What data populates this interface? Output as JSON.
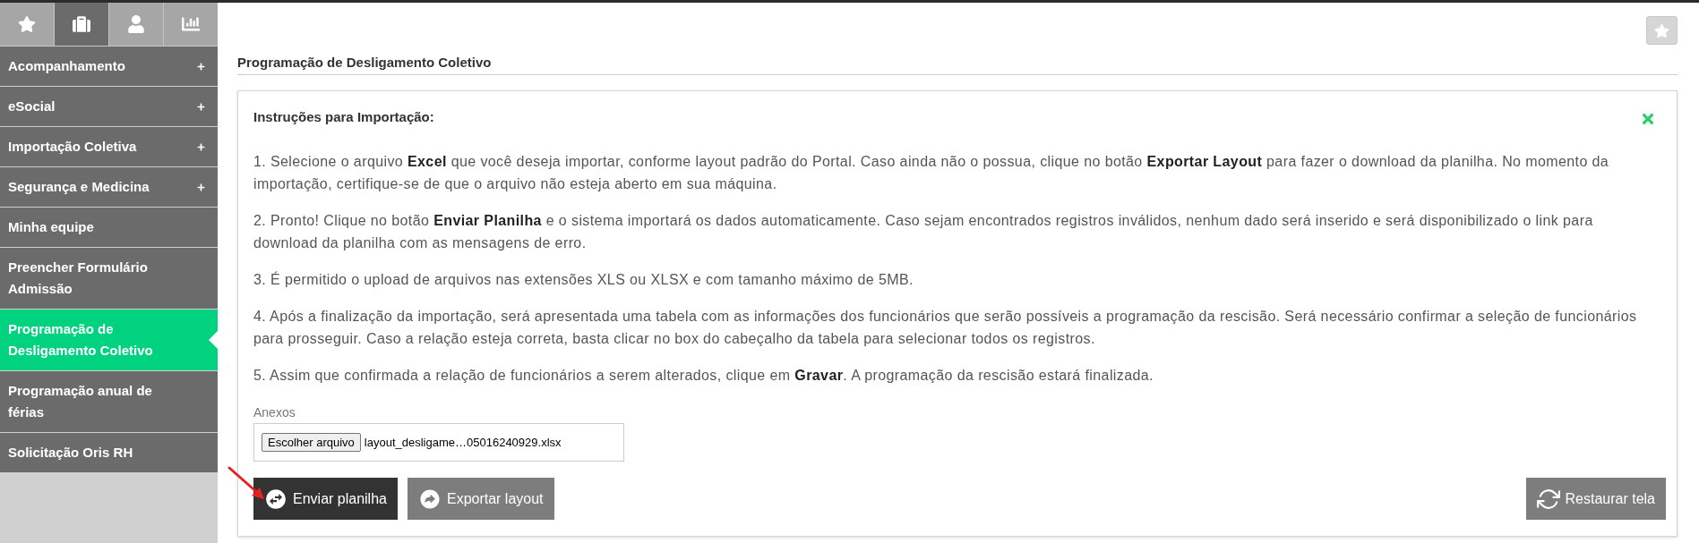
{
  "sidebar": {
    "tabs": [
      {
        "selected": false
      },
      {
        "selected": true
      },
      {
        "selected": false
      },
      {
        "selected": false
      }
    ],
    "menu": [
      {
        "label": "Acompanhamento",
        "kind": "group",
        "selected": false
      },
      {
        "label": "eSocial",
        "kind": "group",
        "selected": false
      },
      {
        "label": "Importação Coletiva",
        "kind": "group",
        "selected": false
      },
      {
        "label": "Segurança e Medicina",
        "kind": "group",
        "selected": false
      },
      {
        "label": "Minha equipe",
        "kind": "link",
        "selected": false
      },
      {
        "label": "Preencher Formulário Admissão",
        "kind": "link",
        "selected": false
      },
      {
        "label": "Programação de Desligamento Coletivo",
        "kind": "link",
        "selected": true
      },
      {
        "label": "Programação anual de férias",
        "kind": "link",
        "selected": false
      },
      {
        "label": "Solicitação Oris RH",
        "kind": "link",
        "selected": false
      }
    ]
  },
  "page_title": "Programação de Desligamento Coletivo",
  "instructions": {
    "title": "Instruções para Importação:",
    "paragraphs": [
      "1. Selecione o arquivo **Excel** que você deseja importar, conforme layout padrão do Portal. Caso ainda não o possua, clique no botão **Exportar Layout** para fazer o download da planilha. No momento da importação, certifique-se de que o arquivo não esteja aberto em sua máquina.",
      "2. Pronto! Clique no botão **Enviar Planilha** e o sistema importará os dados automaticamente. Caso sejam encontrados registros inválidos, nenhum dado será inserido e será disponibilizado o link para download da planilha com as mensagens de erro.",
      "3. É permitido o upload de arquivos nas extensões XLS ou XLSX e com tamanho máximo de 5MB.",
      "4. Após a finalização da importação, será apresentada uma tabela com as informações dos funcionários que serão possíveis a programação da rescisão. Será necessário confirmar a seleção de funcionários para prosseguir. Caso a relação esteja correta, basta clicar no box do cabeçalho da tabela para selecionar todos os registros.",
      "5. Assim que confirmada a relação de funcionários a serem alterados, clique em **Gravar**. A programação da rescisão estará finalizada."
    ]
  },
  "attachments": {
    "label": "Anexos",
    "choose_button": "Escolher arquivo",
    "file_name": "layout_desligame…05016240929.xlsx"
  },
  "buttons": [
    {
      "label": "Enviar planilha",
      "kind": "send"
    },
    {
      "label": "Exportar layout",
      "kind": "export"
    },
    {
      "label": "Restaurar tela",
      "kind": "reset"
    }
  ]
}
